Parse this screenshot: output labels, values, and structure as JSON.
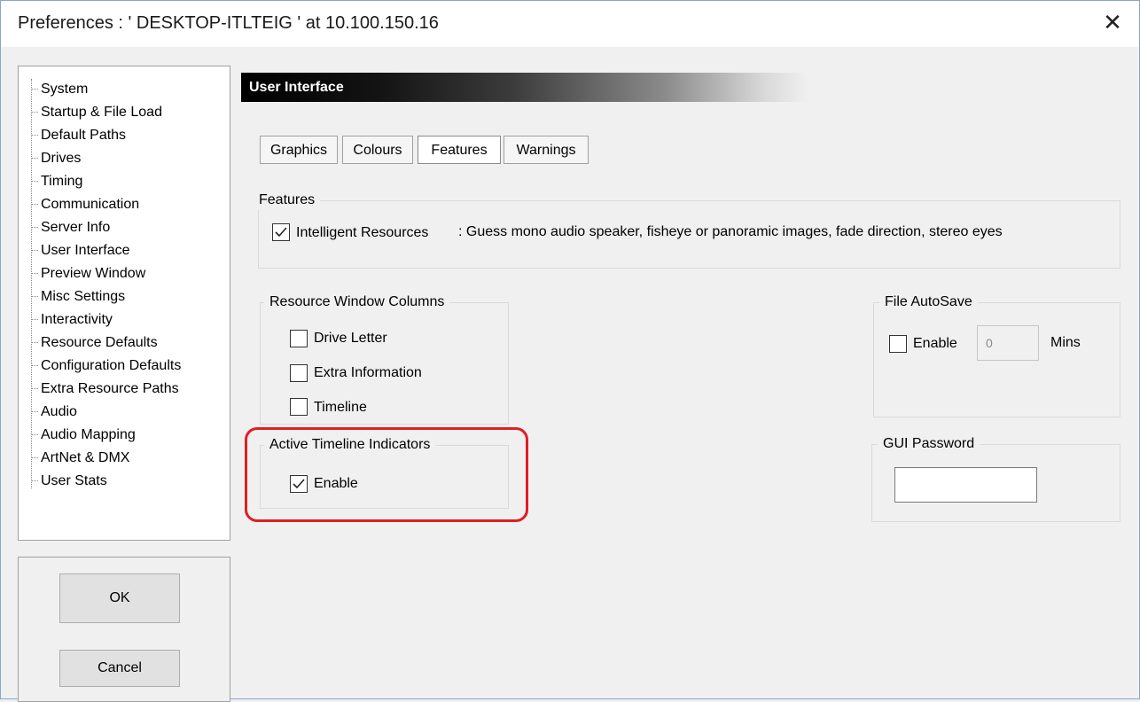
{
  "window": {
    "title": "Preferences  :  ' DESKTOP-ITLTEIG ' at  10.100.150.16",
    "close_glyph": "✕"
  },
  "sidebar": {
    "items": [
      "System",
      "Startup & File Load",
      "Default Paths",
      "Drives",
      "Timing",
      "Communication",
      "Server Info",
      "User Interface",
      "Preview Window",
      "Misc Settings",
      "Interactivity",
      "Resource Defaults",
      "Configuration Defaults",
      "Extra Resource Paths",
      "Audio",
      "Audio Mapping",
      "ArtNet & DMX",
      "User Stats"
    ],
    "selected": "User Interface"
  },
  "buttons": {
    "ok": "OK",
    "cancel": "Cancel"
  },
  "panel": {
    "title": "User Interface"
  },
  "tabs": [
    {
      "label": "Graphics"
    },
    {
      "label": "Colours"
    },
    {
      "label": "Features",
      "active": true
    },
    {
      "label": "Warnings"
    }
  ],
  "features": {
    "group_label": "Features",
    "intelligent_resources": {
      "label": "Intelligent Resources",
      "checked": true
    },
    "description": ": Guess mono audio speaker, fisheye or panoramic images, fade direction, stereo eyes"
  },
  "resource_columns": {
    "group_label": "Resource Window Columns",
    "options": [
      {
        "label": "Drive Letter",
        "checked": false
      },
      {
        "label": "Extra Information",
        "checked": false
      },
      {
        "label": "Timeline",
        "checked": false
      }
    ]
  },
  "active_timeline": {
    "group_label": "Active Timeline Indicators",
    "enable": {
      "label": "Enable",
      "checked": true
    }
  },
  "autosave": {
    "group_label": "File AutoSave",
    "enable": {
      "label": "Enable",
      "checked": false
    },
    "minutes_value": "0",
    "unit": "Mins"
  },
  "gui_password": {
    "group_label": "GUI Password",
    "value": ""
  },
  "colors": {
    "highlight": "#e01e24",
    "header_start": "#000000"
  },
  "icons": {
    "checked": "checkmark-icon",
    "close": "close-icon"
  }
}
